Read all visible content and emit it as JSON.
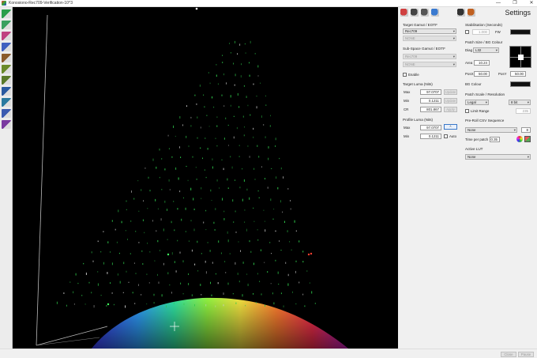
{
  "window": {
    "title": "Konosiono-Rec709-Verification-10^3",
    "minimize": "—",
    "maximize": "❐",
    "close": "✕"
  },
  "left_tools": [
    {
      "icon": "gamut-triangle-icon",
      "color": "#2a9e4a"
    },
    {
      "icon": "gamut-triangle-alt-icon",
      "color": "#3aa060"
    },
    {
      "icon": "chromaticity-icon",
      "color": "#c04080"
    },
    {
      "icon": "cube-icon",
      "color": "#4060c0"
    },
    {
      "icon": "curve-icon",
      "color": "#8a5a2a"
    },
    {
      "icon": "curve-alt-icon",
      "color": "#6a8a2a"
    },
    {
      "icon": "luma-graph-icon",
      "color": "#5a7a2a"
    },
    {
      "icon": "ramp-icon",
      "color": "#2a5aa0"
    },
    {
      "icon": "wave-icon",
      "color": "#2a7aa0"
    },
    {
      "icon": "scope-icon",
      "color": "#3a5ab0"
    },
    {
      "icon": "histogram-icon",
      "color": "#7a3aa0"
    }
  ],
  "panel": {
    "title": "Settings",
    "top_icons": [
      {
        "icon": "colour-patch-icon",
        "color": "#d04040"
      },
      {
        "icon": "probe-icon",
        "color": "#444444"
      },
      {
        "icon": "probe-alt-icon",
        "color": "#555555"
      },
      {
        "icon": "palette-icon",
        "color": "#3a7ad0"
      },
      {
        "icon": "tools-icon",
        "color": "#333333"
      },
      {
        "icon": "cube-colour-icon",
        "color": "#c06020"
      }
    ],
    "target_gamut": {
      "label": "Target Gamut / EOTF",
      "gamut": "Rec709",
      "eotf": "NONE"
    },
    "sub_space": {
      "label": "Sub-Space  Gamut / EOTF",
      "gamut": "Rec709",
      "eotf": "NONE",
      "enable_label": "Enable"
    },
    "target_luma": {
      "label": "Target Luma (Nits)",
      "max_label": "Max",
      "max": "97.0707",
      "min_label": "Min",
      "min": "0.1211",
      "cr_label": "CR",
      "cr": "801.867",
      "update1": "Update",
      "update2": "Update",
      "apply": "Apply"
    },
    "profile_luma": {
      "label": "Profile Luma (Nits)",
      "max_label": "Max",
      "max": "97.0707",
      "min_label": "Min",
      "min": "0.1211",
      "arrow": "^",
      "auto_label": "Auto"
    },
    "stabilisation": {
      "label": "Stabilisation (Seconds)",
      "value": "1.000",
      "fw_label": "FW"
    },
    "patch_size": {
      "label": "Patch Size / BG Colour",
      "diag_label": "Diag",
      "diag": "L32",
      "area_label": "Area",
      "area": "10.24",
      "posx_label": "PosX",
      "posx": "50.00",
      "posy_label": "PosY",
      "posy": "50.00",
      "bg_label": "BG Colour"
    },
    "patch_scale": {
      "label": "Patch Scale / Resolution",
      "scale": "Legal",
      "resolution": "8 bit",
      "limit_label": "Limit Range",
      "limit_value": "235"
    },
    "pre_roll": {
      "label": "Pre-Roll CSV Sequence",
      "sequence": "None",
      "count": "8",
      "time_label": "Time per patch",
      "time": "0.35"
    },
    "active_lut": {
      "label": "Active LUT",
      "value": "None"
    }
  },
  "bottom": {
    "close": "Close",
    "pause": "Pause"
  },
  "colors": {
    "canvas_bg": "#000000",
    "patch_green": "#2ec84a",
    "accent_blue": "#3a78c9"
  }
}
